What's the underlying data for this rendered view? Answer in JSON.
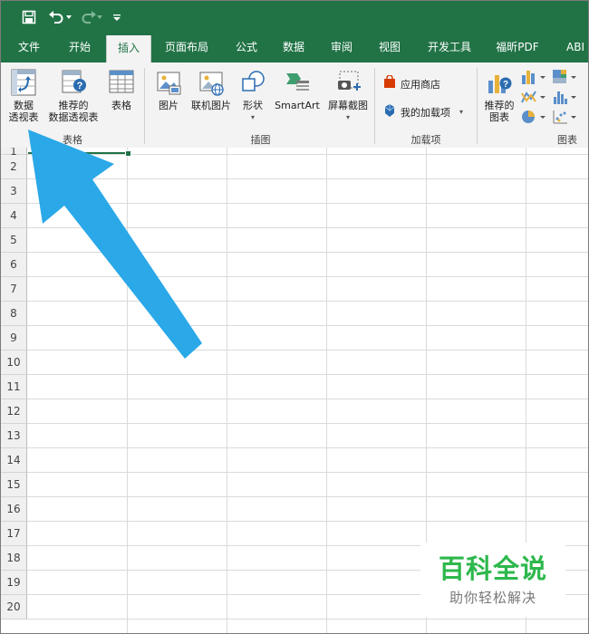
{
  "quick_access": {
    "save_icon": "save-icon",
    "undo_icon": "undo-icon",
    "redo_icon": "redo-icon",
    "customize_icon": "customize-qat-icon"
  },
  "tabs": [
    {
      "label": "文件",
      "active": false
    },
    {
      "label": "开始",
      "active": false
    },
    {
      "label": "插入",
      "active": true
    },
    {
      "label": "页面布局",
      "active": false
    },
    {
      "label": "公式",
      "active": false
    },
    {
      "label": "数据",
      "active": false
    },
    {
      "label": "审阅",
      "active": false
    },
    {
      "label": "视图",
      "active": false
    },
    {
      "label": "开发工具",
      "active": false
    },
    {
      "label": "福昕PDF",
      "active": false
    },
    {
      "label": "ABI",
      "active": false
    }
  ],
  "ribbon": {
    "tables": {
      "pivot_line1": "数据",
      "pivot_line2": "透视表",
      "recommended_line1": "推荐的",
      "recommended_line2": "数据透视表",
      "table": "表格",
      "group": "表格"
    },
    "illustrations": {
      "pictures": "图片",
      "online_pictures": "联机图片",
      "shapes": "形状",
      "smartart": "SmartArt",
      "screenshot": "屏幕截图",
      "group": "插图"
    },
    "addins": {
      "store": "应用商店",
      "my_addins": "我的加载项",
      "group": "加载项"
    },
    "charts": {
      "recommended_line1": "推荐的",
      "recommended_line2": "图表",
      "group": "图表"
    }
  },
  "rows": [
    "1",
    "2",
    "3",
    "4",
    "5",
    "6",
    "7",
    "8",
    "9",
    "10",
    "11",
    "12",
    "13",
    "14",
    "15",
    "16",
    "17",
    "18",
    "19",
    "20"
  ],
  "accent_color": "#217346",
  "arrow_color": "#2aa8e8",
  "watermark": {
    "title": "百科全说",
    "subtitle": "助你轻松解决"
  }
}
